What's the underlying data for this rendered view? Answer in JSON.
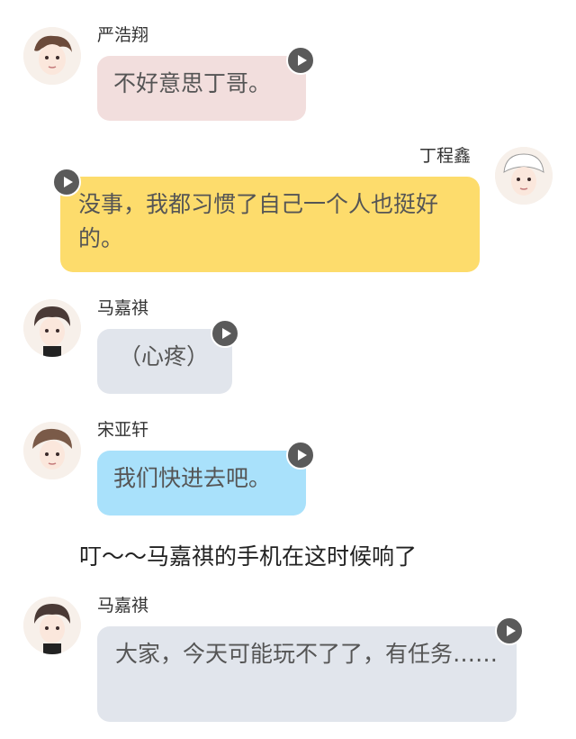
{
  "messages": [
    {
      "sender": "严浩翔",
      "text": "不好意思丁哥。",
      "bubble_color": "#f2dedd",
      "side": "left"
    },
    {
      "sender": "丁程鑫",
      "text": "没事，我都习惯了自己一个人也挺好的。",
      "bubble_color": "#fddc6c",
      "side": "right"
    },
    {
      "sender": "马嘉祺",
      "text": "（心疼）",
      "bubble_color": "#e1e5ec",
      "side": "left"
    },
    {
      "sender": "宋亚轩",
      "text": "我们快进去吧。",
      "bubble_color": "#a9e1fb",
      "side": "left"
    },
    {
      "sender": "马嘉祺",
      "text": "大家，今天可能玩不了了，有任务……",
      "bubble_color": "#e1e5ec",
      "side": "left"
    }
  ],
  "narration": "叮～～马嘉祺的手机在这时候响了",
  "icons": {
    "play": "play-icon",
    "avatar": "avatar"
  }
}
